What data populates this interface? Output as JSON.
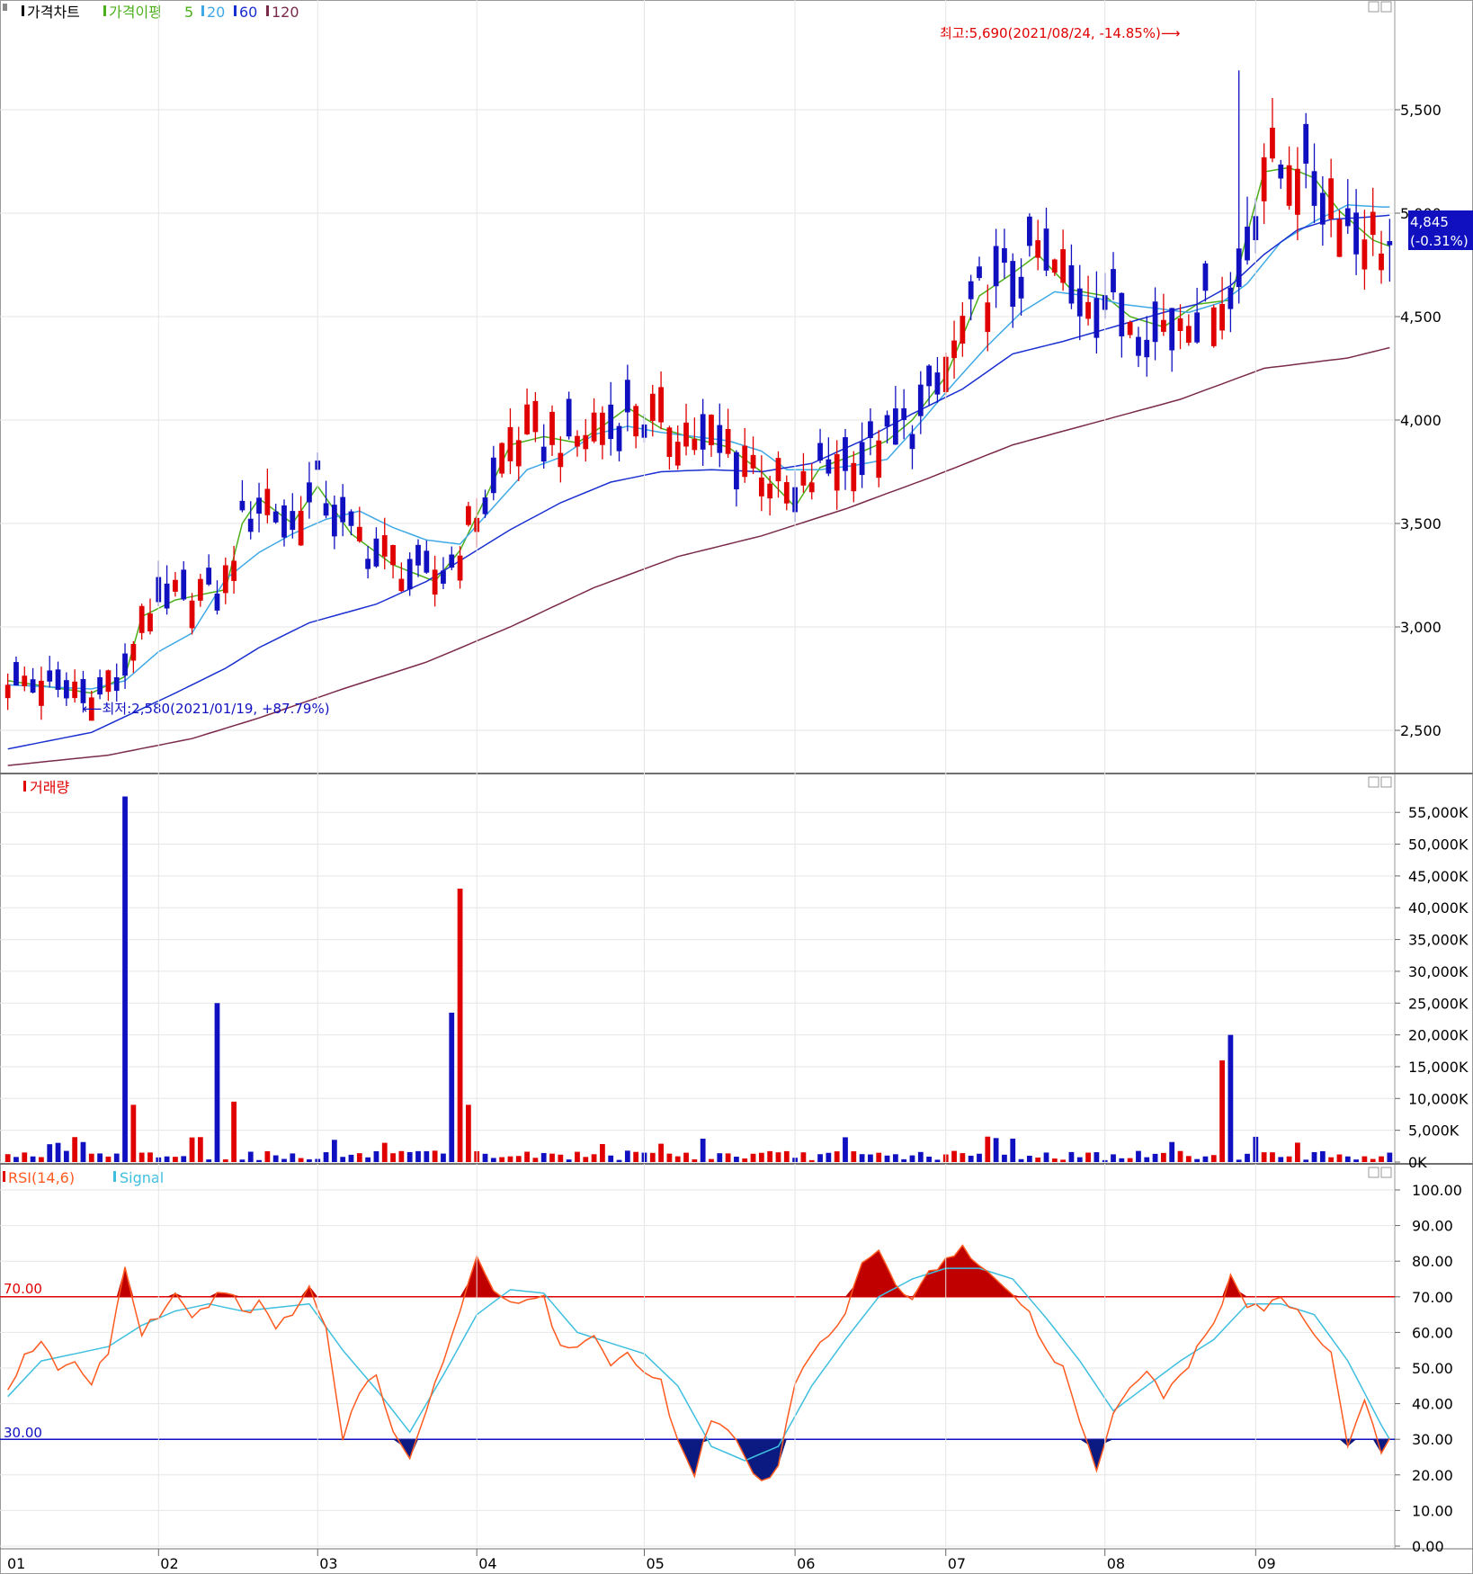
{
  "panels": {
    "price": {
      "legend_title": "가격차트",
      "legend_ma_prefix": "가격이평",
      "ma_labels": [
        "5",
        "20",
        "60",
        "120"
      ],
      "ma_colors": [
        "#4caf1a",
        "#3fa9e6",
        "#1a2fd0",
        "#7a2a4a"
      ],
      "y_ticks": [
        "5,500",
        "5,000",
        "4,500",
        "4,000",
        "3,500",
        "3,000",
        "2,500"
      ],
      "last_price": "4,845",
      "last_change": "(-0.31%)",
      "high_annotation": "최고:5,690(2021/08/24, -14.85%)⟶",
      "low_annotation": "⟵최저:2,580(2021/01/19, +87.79%)"
    },
    "volume": {
      "legend_title": "거래량",
      "y_ticks": [
        "55,000K",
        "50,000K",
        "45,000K",
        "40,000K",
        "35,000K",
        "30,000K",
        "25,000K",
        "20,000K",
        "15,000K",
        "10,000K",
        "5,000K",
        "0K"
      ]
    },
    "rsi": {
      "legend_rsi": "RSI(14,6)",
      "legend_signal": "Signal",
      "y_ticks": [
        "100.00",
        "90.00",
        "80.00",
        "70.00",
        "60.00",
        "50.00",
        "40.00",
        "30.00",
        "20.00",
        "10.00",
        "0.00"
      ],
      "upper_label": "70.00",
      "lower_label": "30.00"
    }
  },
  "x_axis": {
    "month_labels": [
      "01",
      "02",
      "03",
      "04",
      "05",
      "06",
      "07",
      "08",
      "09"
    ]
  },
  "colors": {
    "up": "#e00000",
    "down": "#1010c0",
    "rsi_line": "#ff5a1f",
    "signal_line": "#3fbfdf",
    "upper_line": "#e00000",
    "lower_line": "#1010c0",
    "grid": "#e6e6e6"
  },
  "chart_data": [
    {
      "type": "candlestick",
      "title": "가격차트",
      "ylim": [
        2300,
        5900
      ],
      "y_ticks": [
        2500,
        3000,
        3500,
        4000,
        4500,
        5000,
        5500
      ],
      "highest": {
        "value": 5690,
        "date": "2021/08/24",
        "change": "-14.85%"
      },
      "lowest": {
        "value": 2580,
        "date": "2021/01/19",
        "change": "+87.79%"
      },
      "last": {
        "value": 4845,
        "change": "-0.31%"
      },
      "ma_anchors": {
        "ma5": [
          [
            0,
            2740
          ],
          [
            10,
            2680
          ],
          [
            14,
            2760
          ],
          [
            16,
            3050
          ],
          [
            20,
            3130
          ],
          [
            26,
            3180
          ],
          [
            28,
            3500
          ],
          [
            30,
            3620
          ],
          [
            34,
            3500
          ],
          [
            37,
            3680
          ],
          [
            41,
            3450
          ],
          [
            46,
            3300
          ],
          [
            51,
            3220
          ],
          [
            54,
            3370
          ],
          [
            57,
            3620
          ],
          [
            60,
            3880
          ],
          [
            64,
            3920
          ],
          [
            68,
            3890
          ],
          [
            71,
            3970
          ],
          [
            74,
            4060
          ],
          [
            78,
            3960
          ],
          [
            82,
            3910
          ],
          [
            86,
            3870
          ],
          [
            90,
            3750
          ],
          [
            94,
            3580
          ],
          [
            97,
            3770
          ],
          [
            101,
            3830
          ],
          [
            105,
            3900
          ],
          [
            108,
            4000
          ],
          [
            112,
            4210
          ],
          [
            116,
            4600
          ],
          [
            120,
            4710
          ],
          [
            123,
            4800
          ],
          [
            127,
            4630
          ],
          [
            131,
            4600
          ],
          [
            134,
            4500
          ],
          [
            138,
            4450
          ],
          [
            142,
            4560
          ],
          [
            146,
            4580
          ],
          [
            148,
            4900
          ],
          [
            150,
            5200
          ],
          [
            153,
            5220
          ],
          [
            156,
            5170
          ],
          [
            159,
            5010
          ],
          [
            163,
            4870
          ],
          [
            165,
            4840
          ]
        ],
        "ma20": [
          [
            0,
            2720
          ],
          [
            10,
            2700
          ],
          [
            14,
            2740
          ],
          [
            18,
            2880
          ],
          [
            22,
            2970
          ],
          [
            26,
            3230
          ],
          [
            30,
            3360
          ],
          [
            34,
            3450
          ],
          [
            38,
            3520
          ],
          [
            42,
            3560
          ],
          [
            46,
            3480
          ],
          [
            50,
            3420
          ],
          [
            54,
            3400
          ],
          [
            58,
            3580
          ],
          [
            62,
            3760
          ],
          [
            66,
            3820
          ],
          [
            70,
            3930
          ],
          [
            74,
            3970
          ],
          [
            78,
            3940
          ],
          [
            82,
            3920
          ],
          [
            86,
            3900
          ],
          [
            90,
            3850
          ],
          [
            93,
            3760
          ],
          [
            97,
            3760
          ],
          [
            101,
            3780
          ],
          [
            105,
            3810
          ],
          [
            109,
            3990
          ],
          [
            113,
            4180
          ],
          [
            117,
            4360
          ],
          [
            121,
            4520
          ],
          [
            125,
            4620
          ],
          [
            129,
            4600
          ],
          [
            133,
            4560
          ],
          [
            137,
            4540
          ],
          [
            141,
            4520
          ],
          [
            145,
            4570
          ],
          [
            148,
            4660
          ],
          [
            152,
            4860
          ],
          [
            156,
            4960
          ],
          [
            160,
            5040
          ],
          [
            164,
            5030
          ]
        ],
        "ma60": [
          [
            0,
            2410
          ],
          [
            10,
            2490
          ],
          [
            20,
            2680
          ],
          [
            26,
            2800
          ],
          [
            30,
            2900
          ],
          [
            36,
            3020
          ],
          [
            44,
            3110
          ],
          [
            50,
            3220
          ],
          [
            54,
            3320
          ],
          [
            60,
            3470
          ],
          [
            66,
            3600
          ],
          [
            72,
            3700
          ],
          [
            78,
            3750
          ],
          [
            84,
            3760
          ],
          [
            90,
            3750
          ],
          [
            96,
            3790
          ],
          [
            102,
            3900
          ],
          [
            108,
            4030
          ],
          [
            114,
            4150
          ],
          [
            120,
            4320
          ],
          [
            126,
            4380
          ],
          [
            132,
            4450
          ],
          [
            138,
            4520
          ],
          [
            142,
            4560
          ],
          [
            146,
            4650
          ],
          [
            150,
            4800
          ],
          [
            154,
            4920
          ],
          [
            158,
            4970
          ],
          [
            162,
            4980
          ],
          [
            165,
            4990
          ]
        ],
        "ma120": [
          [
            0,
            2330
          ],
          [
            12,
            2380
          ],
          [
            22,
            2460
          ],
          [
            30,
            2560
          ],
          [
            40,
            2700
          ],
          [
            50,
            2830
          ],
          [
            60,
            3000
          ],
          [
            70,
            3190
          ],
          [
            80,
            3340
          ],
          [
            90,
            3440
          ],
          [
            100,
            3570
          ],
          [
            110,
            3720
          ],
          [
            120,
            3880
          ],
          [
            130,
            3990
          ],
          [
            140,
            4100
          ],
          [
            150,
            4250
          ],
          [
            160,
            4300
          ],
          [
            165,
            4350
          ]
        ]
      },
      "series_note": ""
    },
    {
      "type": "bar",
      "title": "거래량",
      "ylim": [
        0,
        58000
      ],
      "spikes_k": [
        [
          14,
          57500
        ],
        [
          15,
          9000
        ],
        [
          25,
          25000
        ],
        [
          27,
          9500
        ],
        [
          53,
          23500
        ],
        [
          54,
          43000
        ],
        [
          55,
          9000
        ],
        [
          145,
          16000
        ],
        [
          146,
          20000
        ]
      ]
    },
    {
      "type": "line",
      "title": "RSI(14,6)",
      "ylim": [
        0,
        100
      ],
      "upper_level": 70,
      "lower_level": 30,
      "rsi_anchors": [
        [
          0,
          44
        ],
        [
          2,
          54
        ],
        [
          4,
          58
        ],
        [
          6,
          48
        ],
        [
          8,
          52
        ],
        [
          10,
          46
        ],
        [
          12,
          55
        ],
        [
          14,
          78
        ],
        [
          16,
          60
        ],
        [
          18,
          65
        ],
        [
          20,
          70
        ],
        [
          22,
          63
        ],
        [
          24,
          68
        ],
        [
          26,
          72
        ],
        [
          28,
          66
        ],
        [
          30,
          68
        ],
        [
          32,
          62
        ],
        [
          34,
          65
        ],
        [
          36,
          73
        ],
        [
          38,
          62
        ],
        [
          40,
          30
        ],
        [
          42,
          44
        ],
        [
          44,
          48
        ],
        [
          46,
          32
        ],
        [
          48,
          26
        ],
        [
          50,
          38
        ],
        [
          52,
          52
        ],
        [
          54,
          65
        ],
        [
          56,
          82
        ],
        [
          58,
          72
        ],
        [
          60,
          69
        ],
        [
          62,
          68
        ],
        [
          64,
          70
        ],
        [
          66,
          55
        ],
        [
          68,
          56
        ],
        [
          70,
          58
        ],
        [
          72,
          52
        ],
        [
          74,
          55
        ],
        [
          76,
          48
        ],
        [
          78,
          46
        ],
        [
          80,
          30
        ],
        [
          82,
          21
        ],
        [
          84,
          36
        ],
        [
          86,
          32
        ],
        [
          88,
          25
        ],
        [
          90,
          17
        ],
        [
          92,
          22
        ],
        [
          94,
          46
        ],
        [
          96,
          55
        ],
        [
          98,
          60
        ],
        [
          100,
          64
        ],
        [
          102,
          80
        ],
        [
          104,
          82
        ],
        [
          106,
          74
        ],
        [
          108,
          69
        ],
        [
          110,
          78
        ],
        [
          112,
          80
        ],
        [
          114,
          84
        ],
        [
          116,
          78
        ],
        [
          118,
          75
        ],
        [
          120,
          72
        ],
        [
          122,
          65
        ],
        [
          124,
          55
        ],
        [
          126,
          50
        ],
        [
          128,
          35
        ],
        [
          130,
          22
        ],
        [
          132,
          38
        ],
        [
          134,
          45
        ],
        [
          136,
          50
        ],
        [
          138,
          42
        ],
        [
          140,
          48
        ],
        [
          142,
          55
        ],
        [
          144,
          62
        ],
        [
          146,
          76
        ],
        [
          148,
          68
        ],
        [
          150,
          66
        ],
        [
          152,
          70
        ],
        [
          154,
          65
        ],
        [
          156,
          60
        ],
        [
          158,
          55
        ],
        [
          160,
          28
        ],
        [
          162,
          42
        ],
        [
          164,
          25
        ],
        [
          165,
          30
        ]
      ],
      "signal_anchors": [
        [
          0,
          42
        ],
        [
          4,
          52
        ],
        [
          8,
          54
        ],
        [
          12,
          56
        ],
        [
          16,
          62
        ],
        [
          20,
          66
        ],
        [
          24,
          68
        ],
        [
          28,
          66
        ],
        [
          32,
          67
        ],
        [
          36,
          68
        ],
        [
          40,
          55
        ],
        [
          44,
          44
        ],
        [
          48,
          32
        ],
        [
          52,
          48
        ],
        [
          56,
          65
        ],
        [
          60,
          72
        ],
        [
          64,
          71
        ],
        [
          68,
          60
        ],
        [
          72,
          57
        ],
        [
          76,
          54
        ],
        [
          80,
          45
        ],
        [
          84,
          28
        ],
        [
          88,
          24
        ],
        [
          92,
          28
        ],
        [
          96,
          45
        ],
        [
          100,
          58
        ],
        [
          104,
          70
        ],
        [
          108,
          75
        ],
        [
          112,
          78
        ],
        [
          116,
          78
        ],
        [
          120,
          75
        ],
        [
          124,
          64
        ],
        [
          128,
          52
        ],
        [
          132,
          38
        ],
        [
          136,
          45
        ],
        [
          140,
          52
        ],
        [
          144,
          58
        ],
        [
          148,
          68
        ],
        [
          152,
          68
        ],
        [
          156,
          65
        ],
        [
          160,
          52
        ],
        [
          164,
          34
        ],
        [
          165,
          30
        ]
      ]
    }
  ]
}
